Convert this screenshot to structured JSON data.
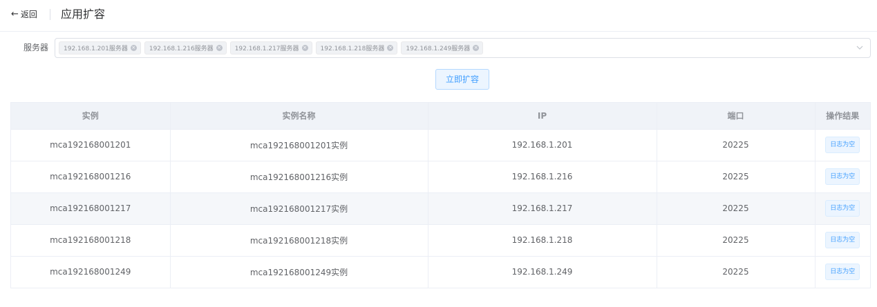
{
  "header": {
    "back_arrow": "←",
    "back_label": "返回",
    "title": "应用扩容"
  },
  "form": {
    "server_label": "服务器",
    "tags": [
      {
        "label": "192.168.1.201服务器"
      },
      {
        "label": "192.168.1.216服务器"
      },
      {
        "label": "192.168.1.217服务器"
      },
      {
        "label": "192.168.1.218服务器"
      },
      {
        "label": "192.168.1.249服务器"
      }
    ],
    "tag_close_glyph": "×",
    "caret_icon": "chevron-down-icon"
  },
  "actions": {
    "expand_label": "立即扩容"
  },
  "table": {
    "columns": [
      "实例",
      "实例名称",
      "IP",
      "端口",
      "操作结果"
    ],
    "rows": [
      {
        "instance": "mca192168001201",
        "name": "mca192168001201实例",
        "ip": "192.168.1.201",
        "port": "20225",
        "result": "日志为空"
      },
      {
        "instance": "mca192168001216",
        "name": "mca192168001216实例",
        "ip": "192.168.1.216",
        "port": "20225",
        "result": "日志为空"
      },
      {
        "instance": "mca192168001217",
        "name": "mca192168001217实例",
        "ip": "192.168.1.217",
        "port": "20225",
        "result": "日志为空"
      },
      {
        "instance": "mca192168001218",
        "name": "mca192168001218实例",
        "ip": "192.168.1.218",
        "port": "20225",
        "result": "日志为空"
      },
      {
        "instance": "mca192168001249",
        "name": "mca192168001249实例",
        "ip": "192.168.1.249",
        "port": "20225",
        "result": "日志为空"
      }
    ]
  },
  "colors": {
    "primary": "#409eff",
    "primary_light": "#ecf5ff",
    "header_bg": "#f0f3f8",
    "stripe_bg": "#f5f7fa",
    "border": "#ebeef5"
  }
}
